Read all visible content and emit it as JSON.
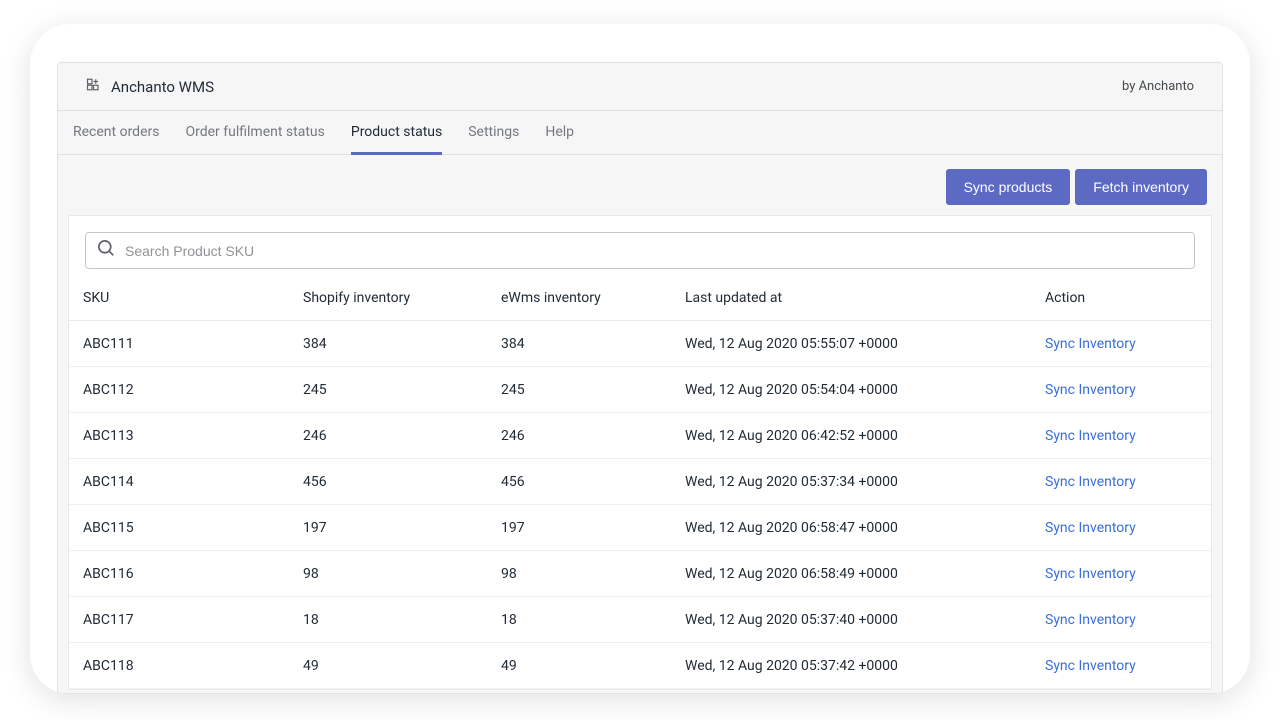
{
  "header": {
    "title": "Anchanto WMS",
    "byline": "by Anchanto"
  },
  "tabs": {
    "items": [
      {
        "label": "Recent orders",
        "active": false
      },
      {
        "label": "Order fulfilment status",
        "active": false
      },
      {
        "label": "Product status",
        "active": true
      },
      {
        "label": "Settings",
        "active": false
      },
      {
        "label": "Help",
        "active": false
      }
    ]
  },
  "toolbar": {
    "sync_products_label": "Sync products",
    "fetch_inventory_label": "Fetch inventory"
  },
  "search": {
    "placeholder": "Search Product SKU"
  },
  "table": {
    "columns": {
      "sku": "SKU",
      "shopify": "Shopify inventory",
      "ewms": "eWms inventory",
      "updated": "Last updated at",
      "action": "Action"
    },
    "action_label": "Sync Inventory",
    "rows": [
      {
        "sku": "ABC111",
        "shopify": "384",
        "ewms": "384",
        "updated": "Wed, 12 Aug 2020 05:55:07 +0000"
      },
      {
        "sku": "ABC112",
        "shopify": "245",
        "ewms": "245",
        "updated": "Wed, 12 Aug 2020 05:54:04 +0000"
      },
      {
        "sku": "ABC113",
        "shopify": "246",
        "ewms": "246",
        "updated": "Wed, 12 Aug 2020 06:42:52 +0000"
      },
      {
        "sku": "ABC114",
        "shopify": "456",
        "ewms": "456",
        "updated": "Wed, 12 Aug 2020 05:37:34 +0000"
      },
      {
        "sku": "ABC115",
        "shopify": "197",
        "ewms": "197",
        "updated": "Wed, 12 Aug 2020 06:58:47 +0000"
      },
      {
        "sku": "ABC116",
        "shopify": "98",
        "ewms": "98",
        "updated": "Wed, 12 Aug 2020 06:58:49 +0000"
      },
      {
        "sku": "ABC117",
        "shopify": "18",
        "ewms": "18",
        "updated": "Wed, 12 Aug 2020 05:37:40 +0000"
      },
      {
        "sku": "ABC118",
        "shopify": "49",
        "ewms": "49",
        "updated": "Wed, 12 Aug 2020 05:37:42 +0000"
      }
    ]
  }
}
